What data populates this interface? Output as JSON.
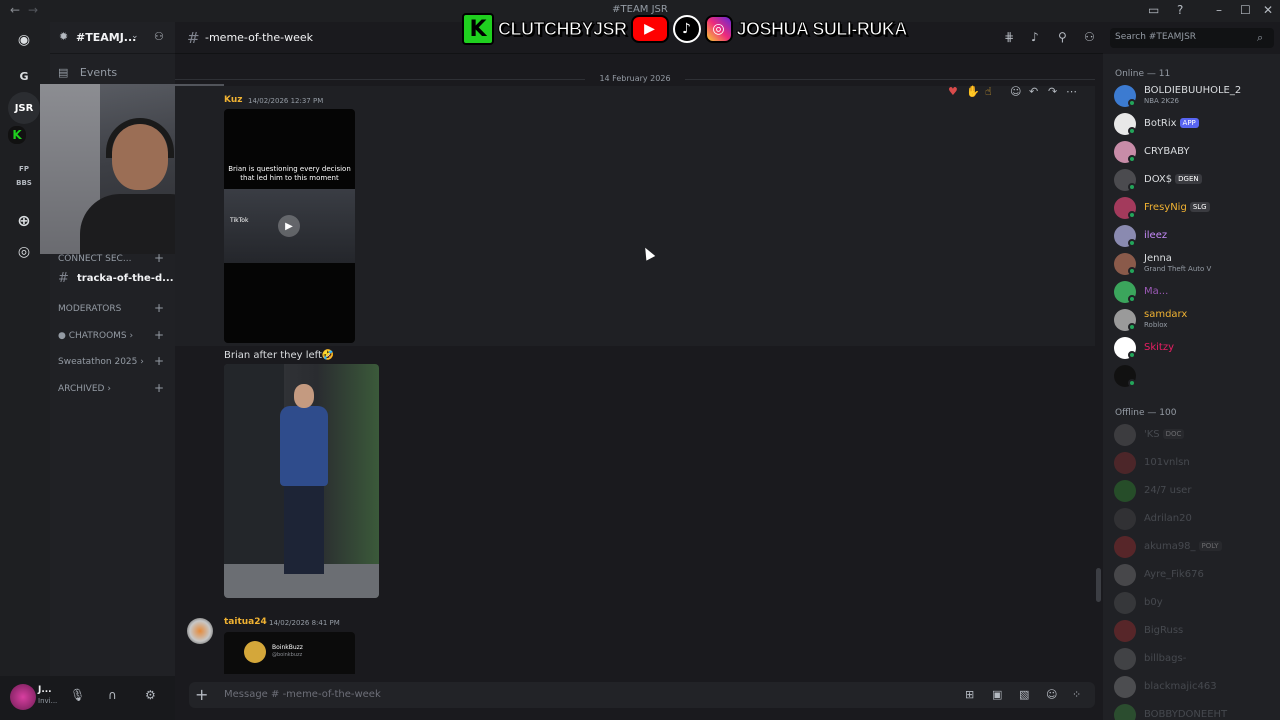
{
  "window": {
    "title": "#TEAM JSR",
    "back_glyph": "←",
    "forward_glyph": "→",
    "min_glyph": "–",
    "max_glyph": "☐",
    "close_glyph": "✕"
  },
  "brand_overlay": {
    "k_glyph": "K",
    "handle": "CLUTCHBYJSR",
    "name": "JOSHUA SULI-RUKA"
  },
  "server": {
    "name": "#TEAMJ...",
    "rail_labels": [
      "G",
      "JSR",
      "K",
      "FP",
      "BBS"
    ]
  },
  "sidebar": {
    "events_label": "Events",
    "connect_label": "CONNECT SEC...",
    "active_channel": "tracka-of-the-d...",
    "categories": [
      "MODERATORS",
      "CHATROOMS",
      "Sweatathon 2025",
      "ARCHIVED"
    ]
  },
  "channel": {
    "name": "-meme-of-the-week",
    "search_placeholder": "Search #TEAMJSR"
  },
  "messages": {
    "date": "14 February 2026",
    "msg1": {
      "author": "Kuz",
      "time": "14/02/2026 12:37 PM",
      "video_caption": "Brian is questioning every decision that led him to this moment",
      "tiktok_label": "TikTok"
    },
    "msg2": {
      "text": "Brian after they left🤣"
    },
    "msg3": {
      "author": "taitua24",
      "time": "14/02/2026 8:41 PM",
      "card_title": "BoinkBuzz",
      "card_sub": "@boinkbuzz"
    }
  },
  "composer": {
    "placeholder": "Message # -meme-of-the-week"
  },
  "user_panel": {
    "name": "J...",
    "status": "Invi..."
  },
  "members": {
    "online_title": "Online — 11",
    "offline_title": "Offline — 100",
    "online": [
      {
        "name": "BOLDIEBUUHOLE_2",
        "activity": "NBA 2K26",
        "color": "#dbdee1",
        "avatar": "#3c7bd1"
      },
      {
        "name": "BotRix",
        "tag": "APP",
        "tag_color": "#5865f2",
        "color": "#dbdee1",
        "avatar": "#e8e8e8"
      },
      {
        "name": "CRYBABY",
        "color": "#dbdee1",
        "avatar": "#c88ca8"
      },
      {
        "name": "DOX$",
        "tag": "DGEN",
        "tag_color": "#3a3b40",
        "color": "#dbdee1",
        "avatar": "#4b4b4f"
      },
      {
        "name": "FresyNig",
        "tag": "SLG",
        "tag_color": "#3a3b40",
        "color": "#f0b232",
        "avatar": "#a33a5c"
      },
      {
        "name": "ileez",
        "color": "#c58af9",
        "avatar": "#8a8ab0"
      },
      {
        "name": "Jenna",
        "activity": "Grand Theft Auto V",
        "color": "#dbdee1",
        "avatar": "#8a5a4a"
      },
      {
        "name": "Ma...",
        "color": "#9b59b6",
        "avatar": "#3ba55c"
      },
      {
        "name": "samdarx",
        "activity": "Roblox",
        "color": "#f0b232",
        "avatar": "#9a9a9a"
      },
      {
        "name": "Skitzy",
        "color": "#e91e63",
        "avatar": "#ffffff"
      },
      {
        "name": "",
        "color": "#dbdee1",
        "avatar": "#111111"
      }
    ],
    "offline": [
      {
        "name": "'KS",
        "tag": "DOC",
        "tag_color": "#3a3b40",
        "avatar": "#777"
      },
      {
        "name": "101vnlsn",
        "avatar": "#a33"
      },
      {
        "name": "24/7 user",
        "avatar": "#3a3"
      },
      {
        "name": "Adrilan20",
        "avatar": "#555"
      },
      {
        "name": "akuma98_",
        "tag": "POLY",
        "tag_color": "#3a3b40",
        "avatar": "#c33"
      },
      {
        "name": "Ayre_Fik676",
        "avatar": "#999"
      },
      {
        "name": "b0y",
        "avatar": "#666"
      },
      {
        "name": "BigRuss",
        "avatar": "#c33"
      },
      {
        "name": "billbags-",
        "avatar": "#888"
      },
      {
        "name": "blackmajic463",
        "avatar": "#aaa"
      },
      {
        "name": "BOBBYDONEEHT",
        "avatar": "#4a4"
      }
    ]
  },
  "colors": {
    "accent": "#5865f2",
    "online": "#23a55a",
    "idle": "#f0b232",
    "dnd": "#f23f43"
  }
}
